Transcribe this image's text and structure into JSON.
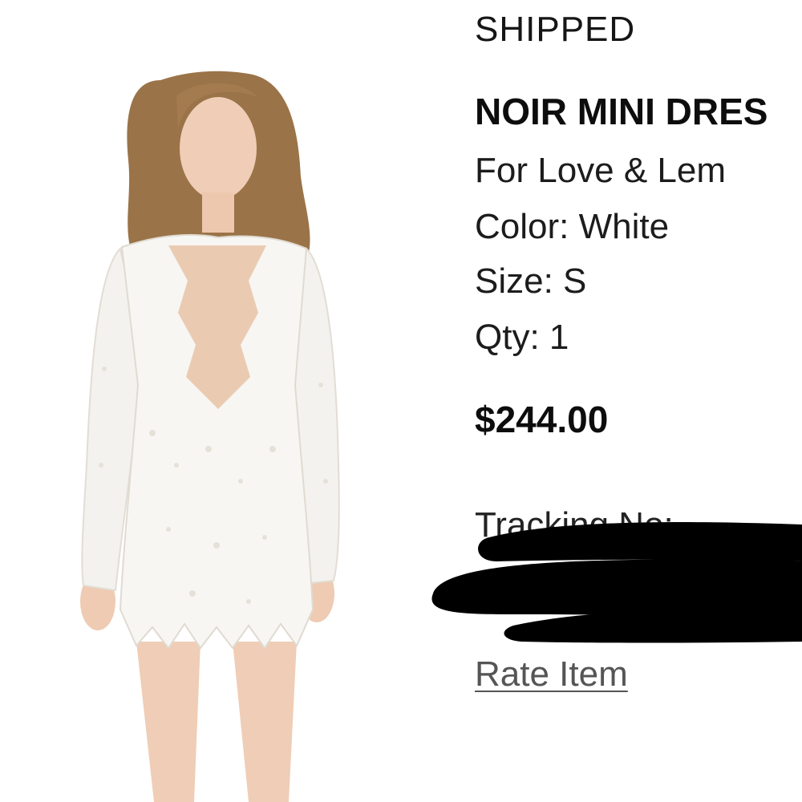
{
  "order": {
    "status": "SHIPPED",
    "product": {
      "name": "NOIR MINI DRES",
      "brand": "For Love & Lem",
      "color_line": "Color: White",
      "size_line": "Size: S",
      "qty_line": "Qty: 1",
      "price": "$244.00",
      "image": "product-photo-white-lace-dress"
    },
    "tracking_label": "Tracking No:",
    "rate_link": "Rate Item",
    "colors": {
      "text": "#1a1a1a",
      "link": "#555555",
      "redaction": "#000000",
      "dress": "#f6f5f2",
      "hair": "#9a7348"
    }
  }
}
